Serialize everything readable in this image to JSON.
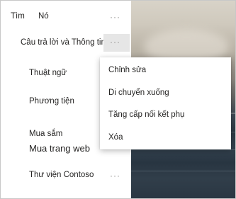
{
  "nav": {
    "items": [
      {
        "label": "Tìm",
        "more": "···"
      },
      {
        "label": "Nó"
      },
      {
        "label": "Câu trả lời và Thông tin",
        "more": "···"
      },
      {
        "label": "Thuật ngữ"
      },
      {
        "label": "Phương tiện"
      },
      {
        "label": "Mua sắm"
      },
      {
        "label": "Mua trang web"
      },
      {
        "label": "Thư viện Contoso",
        "more": "···"
      }
    ]
  },
  "context_menu": {
    "items": [
      {
        "label": "Chỉnh sửa"
      },
      {
        "label": "Di chuyển xuống"
      },
      {
        "label": "Tăng cấp nối kết phụ"
      },
      {
        "label": "Xóa"
      }
    ]
  }
}
